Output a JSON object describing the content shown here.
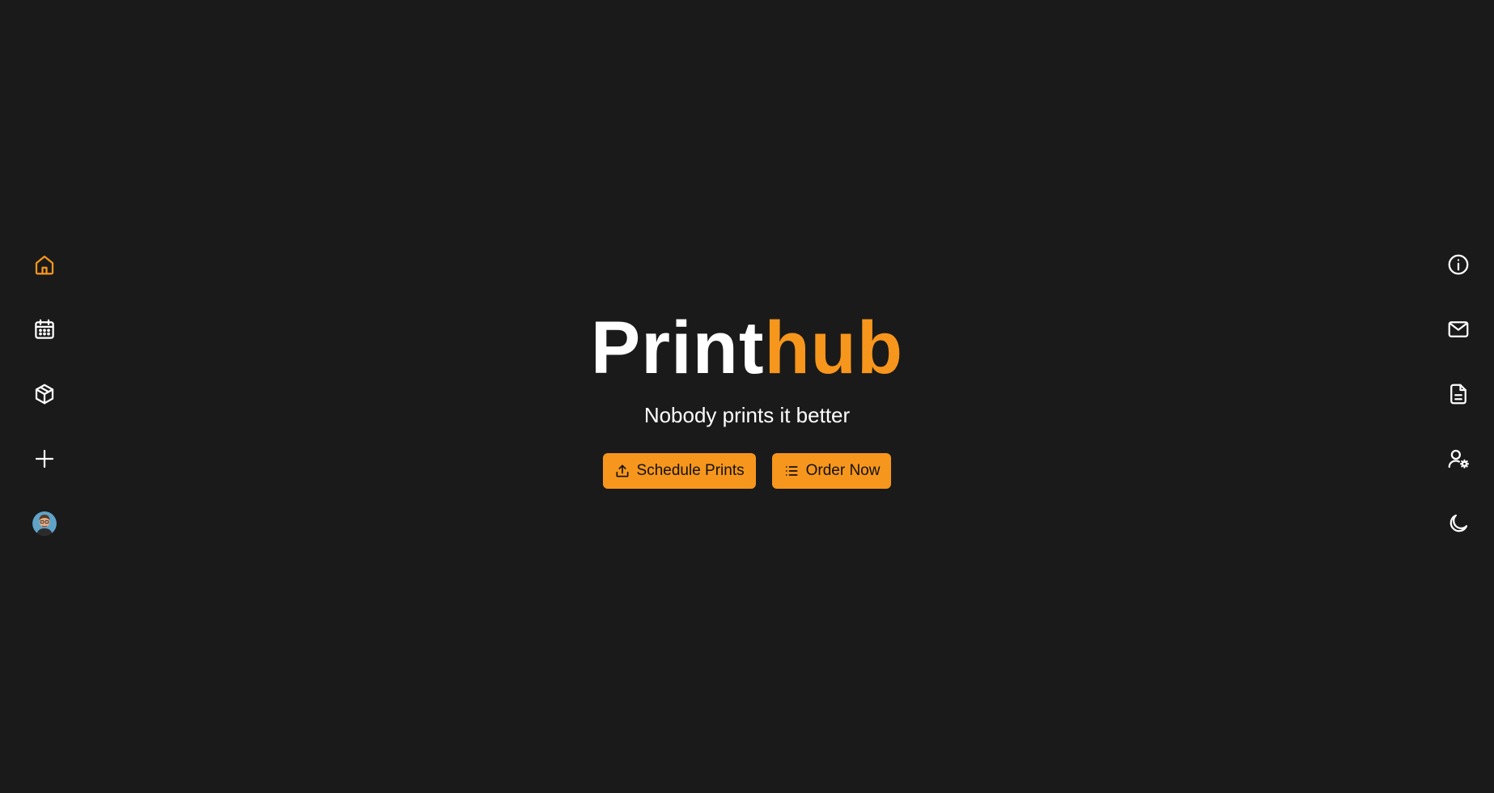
{
  "brand": {
    "primary": "Print",
    "accent": "hub",
    "primary_color": "#ffffff",
    "accent_color": "#f7961c"
  },
  "tagline": "Nobody prints it better",
  "actions": {
    "schedule_label": "Schedule Prints",
    "order_label": "Order Now"
  },
  "left_nav": [
    {
      "icon": "home-icon",
      "active": true
    },
    {
      "icon": "calendar-icon",
      "active": false
    },
    {
      "icon": "package-icon",
      "active": false
    },
    {
      "icon": "plus-icon",
      "active": false
    },
    {
      "icon": "user-avatar",
      "active": false
    }
  ],
  "right_nav": [
    {
      "icon": "info-icon"
    },
    {
      "icon": "mail-icon"
    },
    {
      "icon": "document-icon"
    },
    {
      "icon": "user-settings-icon"
    },
    {
      "icon": "moon-icon"
    }
  ],
  "colors": {
    "background": "#1a1a1a",
    "accent": "#f7961c",
    "icon": "#ffffff"
  }
}
